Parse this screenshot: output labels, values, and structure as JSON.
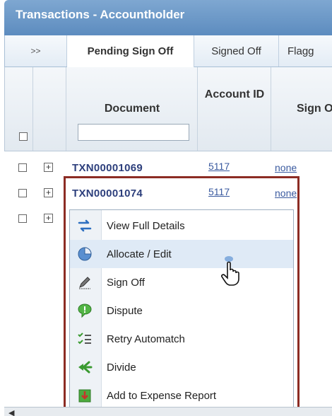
{
  "window": {
    "title": "Transactions - Accountholder"
  },
  "tabs": {
    "arrows": ">>",
    "pending": "Pending Sign Off",
    "signed": "Signed Off",
    "flagged": "Flagg"
  },
  "columns": {
    "document": "Document",
    "account_id": "Account ID",
    "sign_off": "Sign O"
  },
  "rows": [
    {
      "document": "TXN00001069",
      "account": "5117",
      "sign_off": "none"
    },
    {
      "document": "TXN00001074",
      "account": "5117",
      "sign_off": "none"
    },
    {
      "document": "",
      "account": "",
      "sign_off": ""
    }
  ],
  "context_menu": {
    "items": [
      {
        "label": "View Full Details",
        "icon": "swap-arrows-icon"
      },
      {
        "label": "Allocate / Edit",
        "icon": "pie-chart-icon",
        "hovered": true
      },
      {
        "label": "Sign Off",
        "icon": "pen-icon"
      },
      {
        "label": "Dispute",
        "icon": "speech-bubble-icon"
      },
      {
        "label": "Retry Automatch",
        "icon": "checklist-icon"
      },
      {
        "label": "Divide",
        "icon": "split-arrows-icon"
      },
      {
        "label": "Add to Expense Report",
        "icon": "expense-report-icon"
      }
    ]
  },
  "colors": {
    "titlebar": "#6b97c8",
    "highlight_border": "#8c2c24",
    "link": "#3a5a9f",
    "document_id": "#2d3f7c"
  }
}
